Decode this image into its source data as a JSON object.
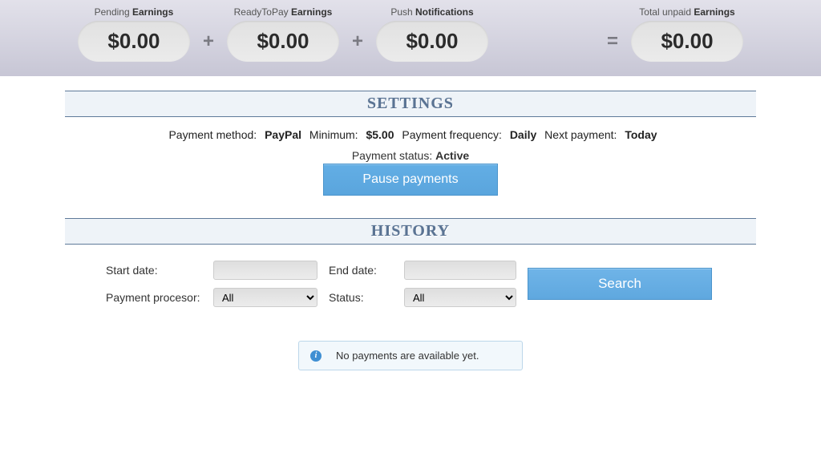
{
  "header": {
    "pending": {
      "label_pre": "Pending ",
      "label_b": "Earnings",
      "value": "$0.00"
    },
    "ready": {
      "label_pre": "ReadyToPay ",
      "label_b": "Earnings",
      "value": "$0.00"
    },
    "push": {
      "label_pre": "Push ",
      "label_b": "Notifications",
      "value": "$0.00"
    },
    "total": {
      "label_pre": "Total unpaid ",
      "label_b": "Earnings",
      "value": "$0.00"
    },
    "op_plus": "+",
    "op_equals": "="
  },
  "settings": {
    "title": "SETTINGS",
    "method_label": "Payment method:",
    "method_value": "PayPal",
    "min_label": "Minimum:",
    "min_value": "$5.00",
    "freq_label": "Payment frequency:",
    "freq_value": "Daily",
    "next_label": "Next payment:",
    "next_value": "Today",
    "status_label": "Payment status:",
    "status_value": "Active",
    "pause_button": "Pause payments"
  },
  "history": {
    "title": "HISTORY",
    "start_label": "Start date:",
    "end_label": "End date:",
    "processor_label": "Payment procesor:",
    "processor_value": "All",
    "status_label": "Status:",
    "status_value": "All",
    "search_button": "Search",
    "empty_message": "No payments are available yet."
  }
}
